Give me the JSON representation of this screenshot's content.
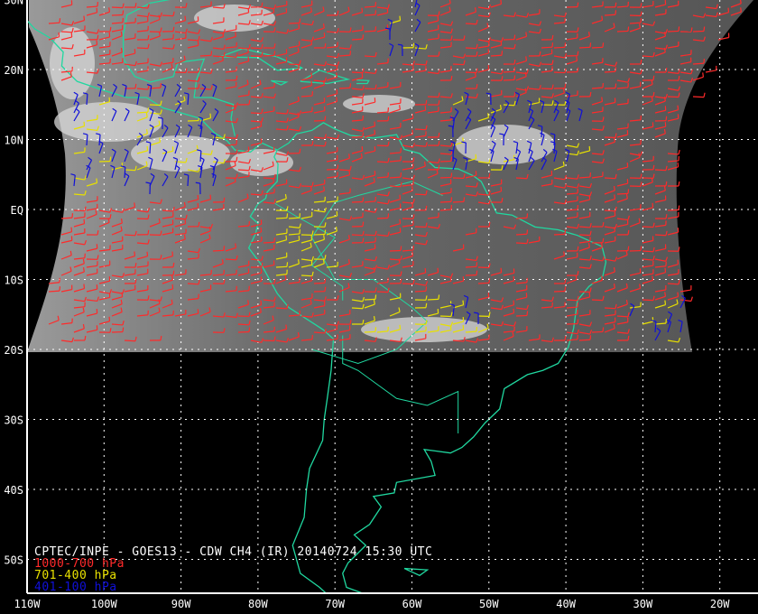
{
  "title": "CPTEC/INPE - GOES13 - CDW CH4 (IR) 20140724 15:30 UTC",
  "legend": [
    {
      "label": "1000-700 hPa",
      "color": "#ff2a2a"
    },
    {
      "label": "701-400 hPa",
      "color": "#e8e000"
    },
    {
      "label": "401-100 hPa",
      "color": "#1010d8"
    }
  ],
  "lat_labels": [
    "30N",
    "20N",
    "10N",
    "EQ",
    "10S",
    "20S",
    "30S",
    "40S",
    "50S"
  ],
  "lon_labels": [
    "110W",
    "100W",
    "90W",
    "80W",
    "70W",
    "60W",
    "50W",
    "40W",
    "30W",
    "20W"
  ],
  "colors": {
    "coast": "#20d8a0",
    "grid": "#ffffff"
  }
}
